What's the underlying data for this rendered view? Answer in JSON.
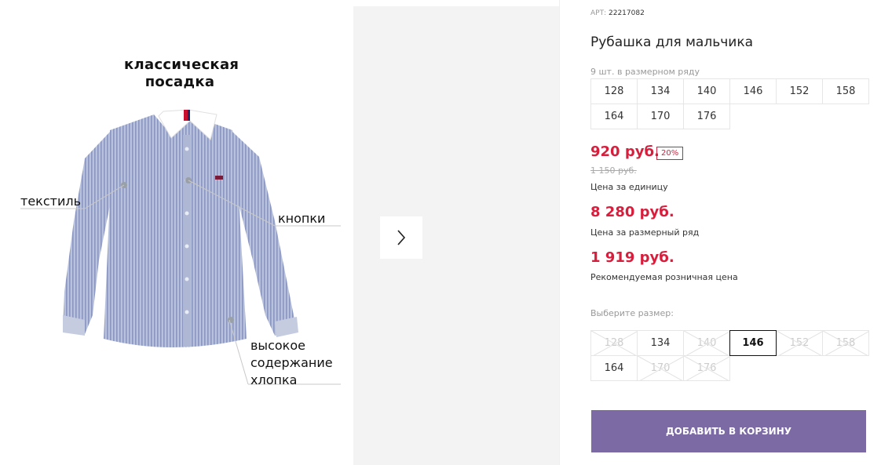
{
  "gallery": {
    "fit_title": [
      "классическая",
      "посадка"
    ],
    "callouts": {
      "textile": "текстиль",
      "buttons": "кнопки",
      "cotton": [
        "высокое",
        "содержание",
        "хлопка"
      ]
    },
    "next_icon": "chevron-right-icon"
  },
  "product": {
    "art_label": "АРТ:",
    "art_number": "22217082",
    "title": "Рубашка для мальчика",
    "run_caption": "9 шт. в размерном ряду",
    "size_run": [
      "128",
      "134",
      "140",
      "146",
      "152",
      "158",
      "164",
      "170",
      "176"
    ],
    "price": "920 руб.",
    "discount": "20%",
    "old_price": "1 150 руб.",
    "price_unit_caption": "Цена за единицу",
    "run_price": "8 280 руб.",
    "run_price_caption": "Цена за размерный ряд",
    "retail_price": "1 919 руб.",
    "retail_price_caption": "Рекомендуемая розничная цена",
    "choose_size_label": "Выберите размер:",
    "size_options": [
      {
        "label": "128",
        "available": false,
        "selected": false
      },
      {
        "label": "134",
        "available": true,
        "selected": false
      },
      {
        "label": "140",
        "available": false,
        "selected": false
      },
      {
        "label": "146",
        "available": true,
        "selected": true
      },
      {
        "label": "152",
        "available": false,
        "selected": false
      },
      {
        "label": "158",
        "available": false,
        "selected": false
      },
      {
        "label": "164",
        "available": true,
        "selected": false
      },
      {
        "label": "170",
        "available": false,
        "selected": false
      },
      {
        "label": "176",
        "available": false,
        "selected": false
      }
    ],
    "add_to_cart": "ДОБАВИТЬ В КОРЗИНУ"
  },
  "colors": {
    "accent_price": "#d71e3c",
    "cart_button": "#7b6aa3"
  }
}
